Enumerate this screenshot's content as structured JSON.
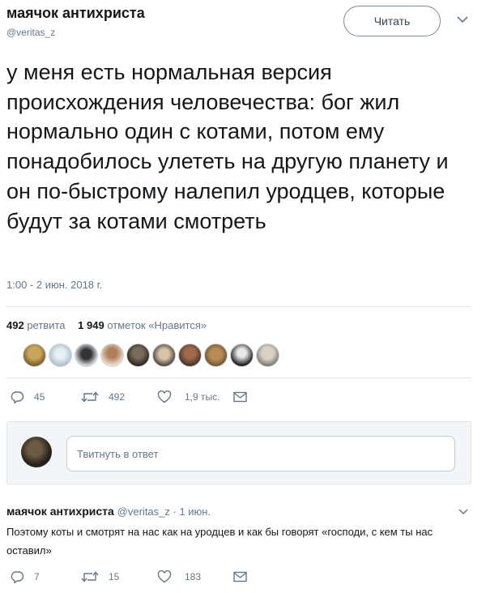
{
  "tweet": {
    "author_name": "маячок антихриста",
    "author_handle": "@veritas_z",
    "follow_label": "Читать",
    "text": "у меня есть нормальная версия происхождения человечества: бог жил нормально один с котами, потом ему понадобилось улететь на другую планету и он по-быстрому налепил уродцев, которые будут за котами смотреть",
    "timestamp": "1:00 - 2 июн. 2018 г.",
    "retweets_count": "492",
    "retweets_label": "ретвита",
    "likes_count": "1 949",
    "likes_label": "отметок «Нравится»",
    "liker_avatar_count": 10,
    "actions": {
      "replies": "45",
      "retweets": "492",
      "likes": "1,9 тыс."
    }
  },
  "reply_composer": {
    "placeholder": "Твитнуть в ответ"
  },
  "reply": {
    "author_name": "маячок антихриста",
    "meta": "@veritas_z · 1 июн.",
    "text": "Поэтому коты и смотрят на нас как на уродцев и как бы говорят «господи, с кем ты нас оставил»",
    "actions": {
      "replies": "7",
      "retweets": "15",
      "likes": "183"
    }
  },
  "colors": {
    "text_primary": "#14171a",
    "text_secondary": "#657786",
    "divider": "#e1e8ed",
    "composer_bg": "#f3f6f9"
  },
  "icons": [
    "chevron-down-icon",
    "reply-icon",
    "retweet-icon",
    "like-icon",
    "message-icon"
  ]
}
